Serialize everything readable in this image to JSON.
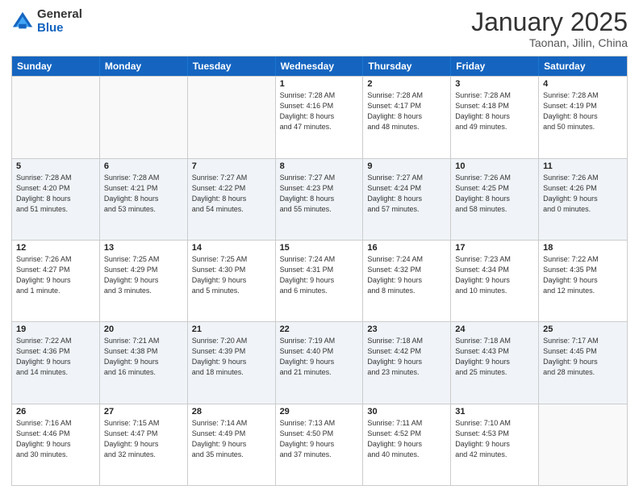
{
  "header": {
    "logo_general": "General",
    "logo_blue": "Blue",
    "month_title": "January 2025",
    "location": "Taonan, Jilin, China"
  },
  "weekdays": [
    "Sunday",
    "Monday",
    "Tuesday",
    "Wednesday",
    "Thursday",
    "Friday",
    "Saturday"
  ],
  "rows": [
    [
      {
        "day": "",
        "info": ""
      },
      {
        "day": "",
        "info": ""
      },
      {
        "day": "",
        "info": ""
      },
      {
        "day": "1",
        "info": "Sunrise: 7:28 AM\nSunset: 4:16 PM\nDaylight: 8 hours\nand 47 minutes."
      },
      {
        "day": "2",
        "info": "Sunrise: 7:28 AM\nSunset: 4:17 PM\nDaylight: 8 hours\nand 48 minutes."
      },
      {
        "day": "3",
        "info": "Sunrise: 7:28 AM\nSunset: 4:18 PM\nDaylight: 8 hours\nand 49 minutes."
      },
      {
        "day": "4",
        "info": "Sunrise: 7:28 AM\nSunset: 4:19 PM\nDaylight: 8 hours\nand 50 minutes."
      }
    ],
    [
      {
        "day": "5",
        "info": "Sunrise: 7:28 AM\nSunset: 4:20 PM\nDaylight: 8 hours\nand 51 minutes."
      },
      {
        "day": "6",
        "info": "Sunrise: 7:28 AM\nSunset: 4:21 PM\nDaylight: 8 hours\nand 53 minutes."
      },
      {
        "day": "7",
        "info": "Sunrise: 7:27 AM\nSunset: 4:22 PM\nDaylight: 8 hours\nand 54 minutes."
      },
      {
        "day": "8",
        "info": "Sunrise: 7:27 AM\nSunset: 4:23 PM\nDaylight: 8 hours\nand 55 minutes."
      },
      {
        "day": "9",
        "info": "Sunrise: 7:27 AM\nSunset: 4:24 PM\nDaylight: 8 hours\nand 57 minutes."
      },
      {
        "day": "10",
        "info": "Sunrise: 7:26 AM\nSunset: 4:25 PM\nDaylight: 8 hours\nand 58 minutes."
      },
      {
        "day": "11",
        "info": "Sunrise: 7:26 AM\nSunset: 4:26 PM\nDaylight: 9 hours\nand 0 minutes."
      }
    ],
    [
      {
        "day": "12",
        "info": "Sunrise: 7:26 AM\nSunset: 4:27 PM\nDaylight: 9 hours\nand 1 minute."
      },
      {
        "day": "13",
        "info": "Sunrise: 7:25 AM\nSunset: 4:29 PM\nDaylight: 9 hours\nand 3 minutes."
      },
      {
        "day": "14",
        "info": "Sunrise: 7:25 AM\nSunset: 4:30 PM\nDaylight: 9 hours\nand 5 minutes."
      },
      {
        "day": "15",
        "info": "Sunrise: 7:24 AM\nSunset: 4:31 PM\nDaylight: 9 hours\nand 6 minutes."
      },
      {
        "day": "16",
        "info": "Sunrise: 7:24 AM\nSunset: 4:32 PM\nDaylight: 9 hours\nand 8 minutes."
      },
      {
        "day": "17",
        "info": "Sunrise: 7:23 AM\nSunset: 4:34 PM\nDaylight: 9 hours\nand 10 minutes."
      },
      {
        "day": "18",
        "info": "Sunrise: 7:22 AM\nSunset: 4:35 PM\nDaylight: 9 hours\nand 12 minutes."
      }
    ],
    [
      {
        "day": "19",
        "info": "Sunrise: 7:22 AM\nSunset: 4:36 PM\nDaylight: 9 hours\nand 14 minutes."
      },
      {
        "day": "20",
        "info": "Sunrise: 7:21 AM\nSunset: 4:38 PM\nDaylight: 9 hours\nand 16 minutes."
      },
      {
        "day": "21",
        "info": "Sunrise: 7:20 AM\nSunset: 4:39 PM\nDaylight: 9 hours\nand 18 minutes."
      },
      {
        "day": "22",
        "info": "Sunrise: 7:19 AM\nSunset: 4:40 PM\nDaylight: 9 hours\nand 21 minutes."
      },
      {
        "day": "23",
        "info": "Sunrise: 7:18 AM\nSunset: 4:42 PM\nDaylight: 9 hours\nand 23 minutes."
      },
      {
        "day": "24",
        "info": "Sunrise: 7:18 AM\nSunset: 4:43 PM\nDaylight: 9 hours\nand 25 minutes."
      },
      {
        "day": "25",
        "info": "Sunrise: 7:17 AM\nSunset: 4:45 PM\nDaylight: 9 hours\nand 28 minutes."
      }
    ],
    [
      {
        "day": "26",
        "info": "Sunrise: 7:16 AM\nSunset: 4:46 PM\nDaylight: 9 hours\nand 30 minutes."
      },
      {
        "day": "27",
        "info": "Sunrise: 7:15 AM\nSunset: 4:47 PM\nDaylight: 9 hours\nand 32 minutes."
      },
      {
        "day": "28",
        "info": "Sunrise: 7:14 AM\nSunset: 4:49 PM\nDaylight: 9 hours\nand 35 minutes."
      },
      {
        "day": "29",
        "info": "Sunrise: 7:13 AM\nSunset: 4:50 PM\nDaylight: 9 hours\nand 37 minutes."
      },
      {
        "day": "30",
        "info": "Sunrise: 7:11 AM\nSunset: 4:52 PM\nDaylight: 9 hours\nand 40 minutes."
      },
      {
        "day": "31",
        "info": "Sunrise: 7:10 AM\nSunset: 4:53 PM\nDaylight: 9 hours\nand 42 minutes."
      },
      {
        "day": "",
        "info": ""
      }
    ]
  ]
}
